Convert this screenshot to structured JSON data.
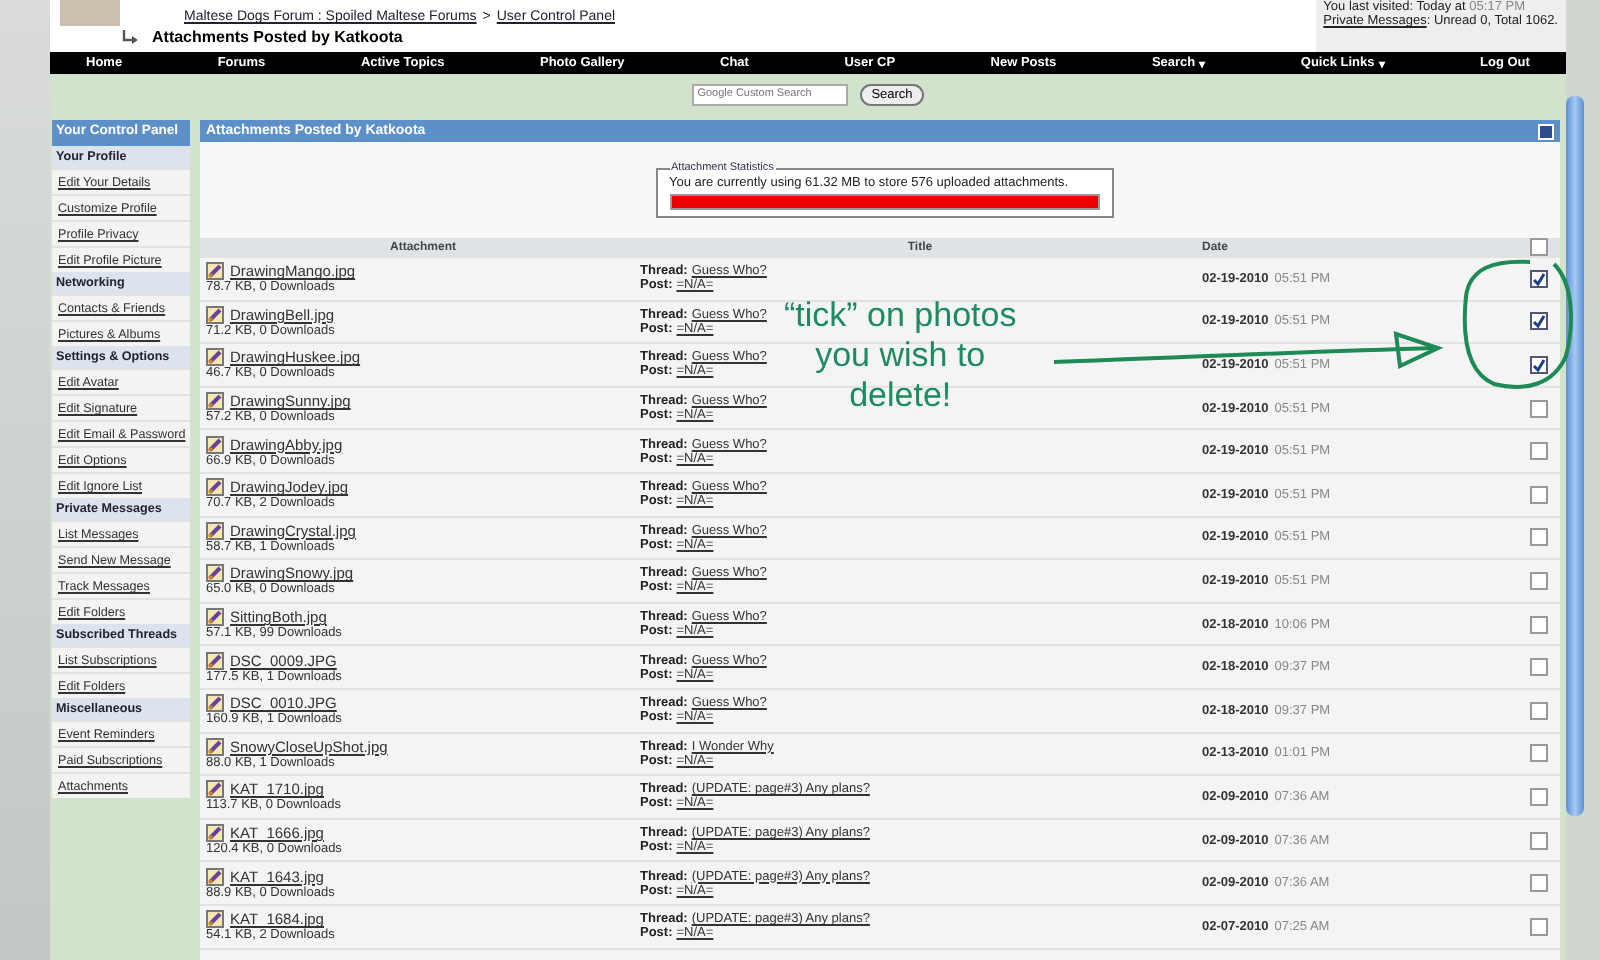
{
  "header": {
    "breadcrumb": [
      "Maltese Dogs Forum : Spoiled Maltese Forums",
      "User Control Panel"
    ],
    "separator": ">",
    "page_title": "Attachments Posted by Katkoota",
    "last_visited": "You last visited: Today at",
    "last_time": "05:17 PM",
    "pm_link": "Private Messages",
    "pm_text": ": Unread 0, Total 1062."
  },
  "navbar": [
    {
      "label": "Home"
    },
    {
      "label": "Forums"
    },
    {
      "label": "Active Topics"
    },
    {
      "label": "Photo Gallery"
    },
    {
      "label": "Chat"
    },
    {
      "label": "User CP"
    },
    {
      "label": "New Posts"
    },
    {
      "label": "Search",
      "caret": "▾"
    },
    {
      "label": "Quick Links",
      "caret": "▾"
    },
    {
      "label": "Log Out"
    }
  ],
  "search": {
    "placeholder": "Google Custom Search",
    "button": "Search"
  },
  "sidebar": {
    "title": "Your Control Panel",
    "sections": [
      {
        "title": "Your Profile",
        "items": [
          "Edit Your Details",
          "Customize Profile",
          "Profile Privacy",
          "Edit Profile Picture"
        ]
      },
      {
        "title": "Networking",
        "items": [
          "Contacts & Friends",
          "Pictures & Albums"
        ]
      },
      {
        "title": "Settings & Options",
        "items": [
          "Edit Avatar",
          "Edit Signature",
          "Edit Email & Password",
          "Edit Options",
          "Edit Ignore List"
        ]
      },
      {
        "title": "Private Messages",
        "items": [
          "List Messages",
          "Send New Message",
          "Track Messages",
          "Edit Folders"
        ]
      },
      {
        "title": "Subscribed Threads",
        "items": [
          "List Subscriptions",
          "Edit Folders"
        ]
      },
      {
        "title": "Miscellaneous",
        "items": [
          "Event Reminders",
          "Paid Subscriptions",
          "Attachments"
        ]
      }
    ]
  },
  "panel": {
    "title": "Attachments Posted by Katkoota",
    "stats": {
      "legend": "Attachment Statistics",
      "text": "You are currently using 61.32 MB to store 576 uploaded attachments.",
      "level": 1
    },
    "columns": [
      "Attachment",
      "Title",
      "Date"
    ],
    "select_all": {
      "checked": false
    },
    "rows": [
      {
        "file": "DrawingMango.jpg",
        "info": "78.7 KB, 0 Downloads",
        "thread_label": "Thread:",
        "thread": "Guess Who?",
        "post_label": "Post:",
        "post": "=N/A=",
        "date": "02-19-2010",
        "time": "05:51 PM",
        "checked": true
      },
      {
        "file": "DrawingBell.jpg",
        "info": "71.2 KB, 0 Downloads",
        "thread_label": "Thread:",
        "thread": "Guess Who?",
        "post_label": "Post:",
        "post": "=N/A=",
        "date": "02-19-2010",
        "time": "05:51 PM",
        "checked": true
      },
      {
        "file": "DrawingHuskee.jpg",
        "info": "46.7 KB, 0 Downloads",
        "thread_label": "Thread:",
        "thread": "Guess Who?",
        "post_label": "Post:",
        "post": "=N/A=",
        "date": "02-19-2010",
        "time": "05:51 PM",
        "checked": true
      },
      {
        "file": "DrawingSunny.jpg",
        "info": "57.2 KB, 0 Downloads",
        "thread_label": "Thread:",
        "thread": "Guess Who?",
        "post_label": "Post:",
        "post": "=N/A=",
        "date": "02-19-2010",
        "time": "05:51 PM",
        "checked": false
      },
      {
        "file": "DrawingAbby.jpg",
        "info": "66.9 KB, 0 Downloads",
        "thread_label": "Thread:",
        "thread": "Guess Who?",
        "post_label": "Post:",
        "post": "=N/A=",
        "date": "02-19-2010",
        "time": "05:51 PM",
        "checked": false
      },
      {
        "file": "DrawingJodey.jpg",
        "info": "70.7 KB, 2 Downloads",
        "thread_label": "Thread:",
        "thread": "Guess Who?",
        "post_label": "Post:",
        "post": "=N/A=",
        "date": "02-19-2010",
        "time": "05:51 PM",
        "checked": false
      },
      {
        "file": "DrawingCrystal.jpg",
        "info": "58.7 KB, 1 Downloads",
        "thread_label": "Thread:",
        "thread": "Guess Who?",
        "post_label": "Post:",
        "post": "=N/A=",
        "date": "02-19-2010",
        "time": "05:51 PM",
        "checked": false
      },
      {
        "file": "DrawingSnowy.jpg",
        "info": "65.0 KB, 0 Downloads",
        "thread_label": "Thread:",
        "thread": "Guess Who?",
        "post_label": "Post:",
        "post": "=N/A=",
        "date": "02-19-2010",
        "time": "05:51 PM",
        "checked": false
      },
      {
        "file": "SittingBoth.jpg",
        "info": "57.1 KB, 99 Downloads",
        "thread_label": "Thread:",
        "thread": "Guess Who?",
        "post_label": "Post:",
        "post": "=N/A=",
        "date": "02-18-2010",
        "time": "10:06 PM",
        "checked": false
      },
      {
        "file": "DSC_0009.JPG",
        "info": "177.5 KB, 1 Downloads",
        "thread_label": "Thread:",
        "thread": "Guess Who?",
        "post_label": "Post:",
        "post": "=N/A=",
        "date": "02-18-2010",
        "time": "09:37 PM",
        "checked": false
      },
      {
        "file": "DSC_0010.JPG",
        "info": "160.9 KB, 1 Downloads",
        "thread_label": "Thread:",
        "thread": "Guess Who?",
        "post_label": "Post:",
        "post": "=N/A=",
        "date": "02-18-2010",
        "time": "09:37 PM",
        "checked": false
      },
      {
        "file": "SnowyCloseUpShot.jpg",
        "info": "88.0 KB, 1 Downloads",
        "thread_label": "Thread:",
        "thread": "I Wonder Why",
        "post_label": "Post:",
        "post": "=N/A=",
        "date": "02-13-2010",
        "time": "01:01 PM",
        "checked": false
      },
      {
        "file": "KAT_1710.jpg",
        "info": "113.7 KB, 0 Downloads",
        "thread_label": "Thread:",
        "thread": "(UPDATE: page#3) Any plans?",
        "post_label": "Post:",
        "post": "=N/A=",
        "date": "02-09-2010",
        "time": "07:36 AM",
        "checked": false
      },
      {
        "file": "KAT_1666.jpg",
        "info": "120.4 KB, 0 Downloads",
        "thread_label": "Thread:",
        "thread": "(UPDATE: page#3) Any plans?",
        "post_label": "Post:",
        "post": "=N/A=",
        "date": "02-09-2010",
        "time": "07:36 AM",
        "checked": false
      },
      {
        "file": "KAT_1643.jpg",
        "info": "88.9 KB, 0 Downloads",
        "thread_label": "Thread:",
        "thread": "(UPDATE: page#3) Any plans?",
        "post_label": "Post:",
        "post": "=N/A=",
        "date": "02-09-2010",
        "time": "07:36 AM",
        "checked": false
      },
      {
        "file": "KAT_1684.jpg",
        "info": "54.1 KB, 2 Downloads",
        "thread_label": "Thread:",
        "thread": "(UPDATE: page#3) Any plans?",
        "post_label": "Post:",
        "post": "=N/A=",
        "date": "02-07-2010",
        "time": "07:25 AM",
        "checked": false
      }
    ]
  },
  "annotation": {
    "lines": [
      "“tick” on photos",
      "you wish to",
      "delete!"
    ]
  }
}
